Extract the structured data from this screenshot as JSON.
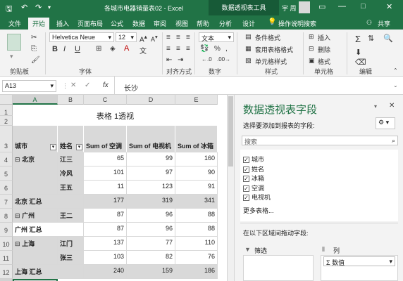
{
  "titlebar": {
    "doc_title": "各城市电器销量表02 - Excel",
    "context_tab": "数据透视表工具",
    "user": "宇 周"
  },
  "tabs": [
    "文件",
    "开始",
    "插入",
    "页面布局",
    "公式",
    "数据",
    "审阅",
    "视图",
    "帮助",
    "分析",
    "设计"
  ],
  "tell_me": "操作说明搜索",
  "share": "共享",
  "ribbon": {
    "font_name": "Helvetica Neue",
    "font_size": "12",
    "font_color_letter": "A",
    "bold": "B",
    "italic": "I",
    "underline": "U",
    "number_format": "文本",
    "cond_format": "条件格式",
    "table_format": "套用表格格式",
    "cell_style": "单元格样式",
    "insert": "插入",
    "delete": "删除",
    "format": "格式",
    "percent": "%",
    "groups": {
      "clipboard": "剪贴板",
      "font": "字体",
      "align": "对齐方式",
      "number": "数字",
      "styles": "样式",
      "cells": "单元格",
      "edit": "编辑"
    }
  },
  "formula": {
    "namebox": "A13",
    "fx": "fx",
    "content": "长沙"
  },
  "sheet": {
    "cols": [
      "A",
      "B",
      "C",
      "D",
      "E"
    ],
    "rows": [
      "1",
      "2",
      "3",
      "4",
      "5",
      "6",
      "7",
      "8",
      "9",
      "10",
      "11",
      "12",
      "13"
    ],
    "title": "表格 1透视",
    "headers": {
      "city": "城市",
      "name": "姓名",
      "ac": "Sum of 空调",
      "tv": "Sum of 电视机",
      "fridge": "Sum of 冰箱"
    },
    "cells": {
      "beijing": "北京",
      "r4n": "江三",
      "r4a": "65",
      "r4b": "99",
      "r4c": "160",
      "r5n": "冷风",
      "r5a": "101",
      "r5b": "97",
      "r5c": "90",
      "r6n": "王五",
      "r6a": "11",
      "r6b": "123",
      "r6c": "91",
      "bjsum": "北京 汇总",
      "bja": "177",
      "bjb": "319",
      "bjc": "341",
      "guangzhou": "广州",
      "r8n": "王二",
      "r8a": "87",
      "r8b": "96",
      "r8c": "88",
      "gzsum": "广州 汇总",
      "gza": "87",
      "gzb": "96",
      "gzc": "88",
      "shanghai": "上海",
      "r10n": "江门",
      "r10a": "137",
      "r10b": "77",
      "r10c": "110",
      "r11n": "张三",
      "r11a": "103",
      "r11b": "82",
      "r11c": "76",
      "shsum": "上海 汇总",
      "sha": "240",
      "shb": "159",
      "shc": "186"
    }
  },
  "pane": {
    "title": "数据透视表字段",
    "subtitle": "选择要添加到报表的字段:",
    "search": "搜索",
    "fields": [
      "城市",
      "姓名",
      "冰箱",
      "空调",
      "电视机"
    ],
    "more": "更多表格...",
    "drag_hint": "在以下区域间拖动字段:",
    "filter": "筛选",
    "columns": "列",
    "values_chip": "Σ 数值"
  }
}
